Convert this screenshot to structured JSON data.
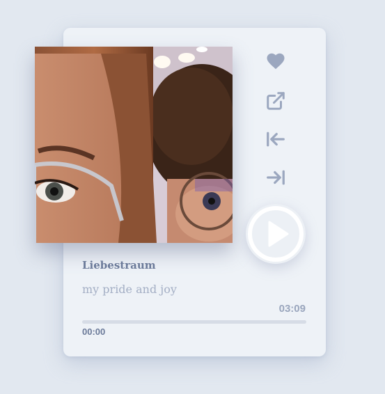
{
  "track": {
    "title": "Liebestraum",
    "artist": "my pride and joy",
    "duration": "03:09",
    "current_time": "00:00",
    "progress_fraction": 0
  },
  "icons": {
    "favorite": "heart-icon",
    "share": "external-link-icon",
    "previous": "previous-icon",
    "next": "next-icon",
    "play": "play-icon"
  },
  "colors": {
    "accent": "#9ba7bf",
    "background": "#e2e8f0",
    "card": "#eef2f7"
  }
}
